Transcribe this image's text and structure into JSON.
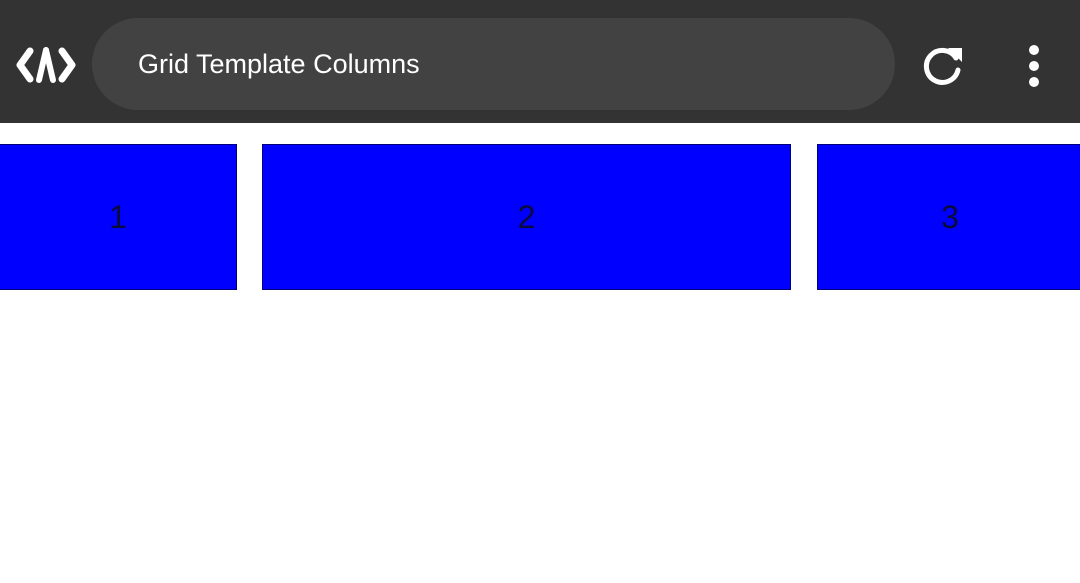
{
  "toolbar": {
    "logo_icon": "code-brackets-icon",
    "address_text": "Grid Template Columns",
    "reload_icon": "reload-icon",
    "menu_icon": "more-vert-icon"
  },
  "grid": {
    "items": [
      {
        "label": "1"
      },
      {
        "label": "2"
      },
      {
        "label": "3"
      }
    ],
    "cell_color": "#0000ff",
    "toolbar_color": "#333333"
  }
}
